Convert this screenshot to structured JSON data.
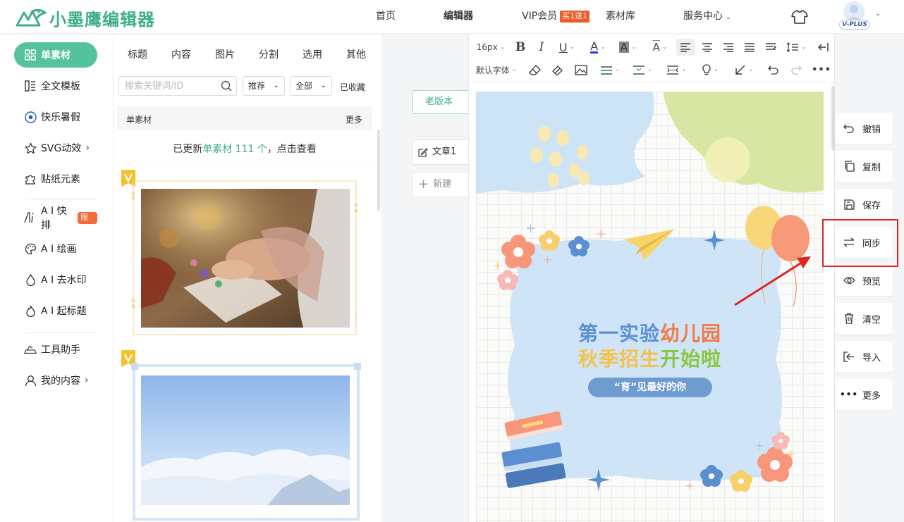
{
  "header": {
    "logo_text": "小墨鹰编辑器",
    "nav": [
      "首页",
      "编辑器",
      "VIP会员",
      "素材库",
      "服务中心"
    ],
    "vip_badge": "买1送1",
    "avatar_badge": "V-PLUS"
  },
  "sidebar": {
    "items": [
      {
        "label": "单素材",
        "icon": "grid-icon"
      },
      {
        "label": "全文模板",
        "icon": "template-icon"
      },
      {
        "label": "快乐暑假",
        "icon": "soccer-ball-icon"
      },
      {
        "label": "SVG动效",
        "icon": "star-icon"
      },
      {
        "label": "贴纸元素",
        "icon": "puzzle-icon"
      },
      {
        "label": "A I 快排",
        "icon": "ai-icon",
        "tag": "限免"
      },
      {
        "label": "A I 绘画",
        "icon": "palette-icon"
      },
      {
        "label": "A I 去水印",
        "icon": "droplet-icon"
      },
      {
        "label": "A I 起标题",
        "icon": "flame-icon"
      },
      {
        "label": "工具助手",
        "icon": "tools-icon"
      },
      {
        "label": "我的内容",
        "icon": "user-icon"
      }
    ]
  },
  "materials": {
    "tabs": [
      "标题",
      "内容",
      "图片",
      "分割",
      "选用",
      "其他"
    ],
    "search_placeholder": "搜索关键词/ID",
    "filter_recommend": "推荐",
    "filter_all": "全部",
    "favorites": "已收藏",
    "section_title": "单素材",
    "section_more": "更多",
    "update_prefix": "已更新",
    "update_highlight": "单素材 111 个",
    "update_suffix": "，点击查看"
  },
  "gutter": {
    "old_version": "老版本",
    "doc_tab": "文章1",
    "new_button": "新建"
  },
  "toolbar": {
    "font_size": "16px",
    "font_family": "默认字体"
  },
  "canvas": {
    "title_line1_a": "第一实验",
    "title_line1_b": "幼儿园",
    "title_line2_a": "秋季招生",
    "title_line2_b": "开始啦",
    "pill": "“育”见最好的你"
  },
  "actions": [
    {
      "label": "撤销",
      "icon": "undo-icon"
    },
    {
      "label": "复制",
      "icon": "copy-icon"
    },
    {
      "label": "保存",
      "icon": "save-icon"
    },
    {
      "label": "同步",
      "icon": "sync-icon"
    },
    {
      "label": "预览",
      "icon": "eye-icon"
    },
    {
      "label": "清空",
      "icon": "trash-icon"
    },
    {
      "label": "导入",
      "icon": "import-icon"
    },
    {
      "label": "更多",
      "icon": "more-icon"
    }
  ],
  "colors": {
    "brand": "#3fae8c",
    "sidebar_active": "#54c39c",
    "highlight": "#e02424",
    "title_blue": "#5b8fd1",
    "title_orange": "#f07b4a",
    "title_yellow": "#f5c24a",
    "title_green": "#8cc63f"
  }
}
